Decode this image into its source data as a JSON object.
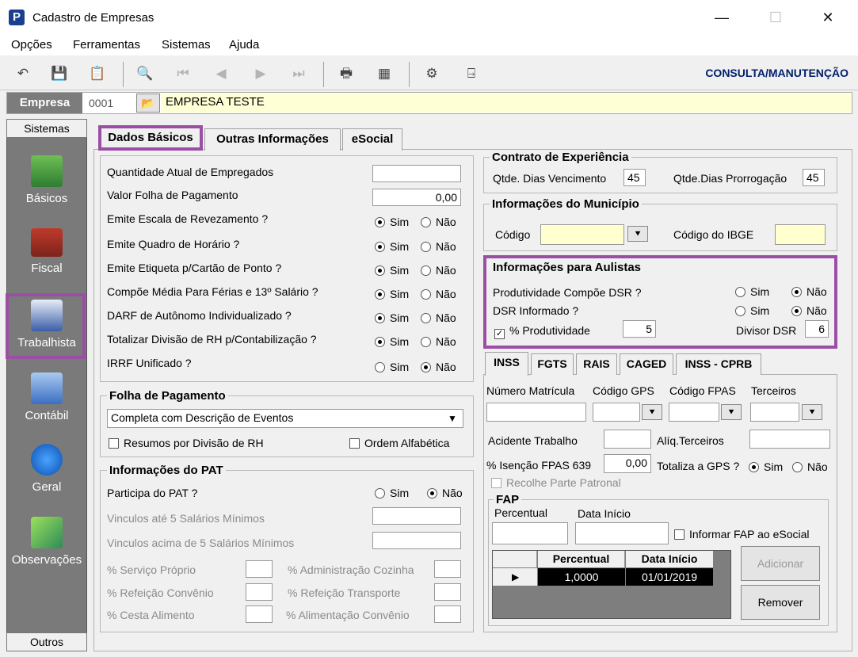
{
  "window": {
    "title": "Cadastro de Empresas",
    "minimize": "—",
    "maximize": "☐",
    "close": "✕"
  },
  "menu": [
    "Opções",
    "Ferramentas",
    "Sistemas",
    "Ajuda"
  ],
  "toolbar": {
    "mode": "CONSULTA/MANUTENÇÃO"
  },
  "empresa": {
    "label": "Empresa",
    "code": "0001",
    "name": "EMPRESA TESTE"
  },
  "sidebar": {
    "top": "Sistemas",
    "bottom": "Outros",
    "items": [
      "Básicos",
      "Fiscal",
      "Trabalhista",
      "Contábil",
      "Geral",
      "Observações"
    ]
  },
  "tabs": {
    "t1": "Dados Básicos",
    "t2": "Outras Informações",
    "t3": "eSocial"
  },
  "yes": "Sim",
  "no": "Não",
  "dados": {
    "qtd_label": "Quantidade Atual de Empregados",
    "qtd_value": "",
    "folha_label": "Valor Folha de Pagamento",
    "folha_value": "0,00",
    "q1": "Emite Escala de Revezamento ?",
    "q2": "Emite Quadro de Horário ?",
    "q3": "Emite Etiqueta p/Cartão de Ponto ?",
    "q4": "Compõe Média Para Férias e 13º Salário ?",
    "q5": "DARF de Autônomo Individualizado ?",
    "q6": "Totalizar Divisão de RH p/Contabilização ?",
    "q7": "IRRF Unificado ?"
  },
  "folha": {
    "title": "Folha de Pagamento",
    "select": "Completa com Descrição de Eventos",
    "resumos": "Resumos por Divisão de RH",
    "ordem": "Ordem Alfabética"
  },
  "pat": {
    "title": "Informações do PAT",
    "participa": "Participa do PAT ?",
    "ate5": "Vinculos até 5 Salários Mínimos",
    "acima5": "Vinculos acima de 5 Salários Mínimos",
    "proprio": "% Serviço Próprio",
    "refeicao": "% Refeição Convênio",
    "cesta": "% Cesta Alimento",
    "admin": "% Administração Cozinha",
    "transporte": "% Refeição Transporte",
    "alimentacao": "% Alimentação Convênio"
  },
  "contrato": {
    "title": "Contrato de Experiência",
    "venc_label": "Qtde. Dias Vencimento",
    "venc": "45",
    "prorr_label": "Qtde.Dias Prorrogação",
    "prorr": "45"
  },
  "municipio": {
    "title": "Informações do Município",
    "codigo": "Código",
    "ibge": "Código do IBGE"
  },
  "aulistas": {
    "title": "Informações para Aulistas",
    "prod": "Produtividade Compõe DSR ?",
    "dsr": "DSR Informado ?",
    "pct_label": "% Produtividade",
    "pct": "5",
    "divisor_label": "Divisor DSR",
    "divisor": "6"
  },
  "inss_tabs": [
    "INSS",
    "FGTS",
    "RAIS",
    "CAGED",
    "INSS - CPRB"
  ],
  "inss": {
    "matricula": "Número Matrícula",
    "gps": "Código GPS",
    "fpas": "Código FPAS",
    "terceiros": "Terceiros",
    "acidente": "Acidente Trabalho",
    "aliq": "Alíq.Terceiros",
    "isencao": "% Isenção FPAS 639",
    "isencao_value": "0,00",
    "totaliza": "Totaliza a GPS ?",
    "recolhe": "Recolhe Parte Patronal"
  },
  "fap": {
    "title": "FAP",
    "percentual": "Percentual",
    "data_inicio": "Data Início",
    "informar": "Informar FAP ao eSocial",
    "col1": "Percentual",
    "col2": "Data Início",
    "row_pct": "1,0000",
    "row_data": "01/01/2019",
    "adicionar": "Adicionar",
    "remover": "Remover"
  }
}
